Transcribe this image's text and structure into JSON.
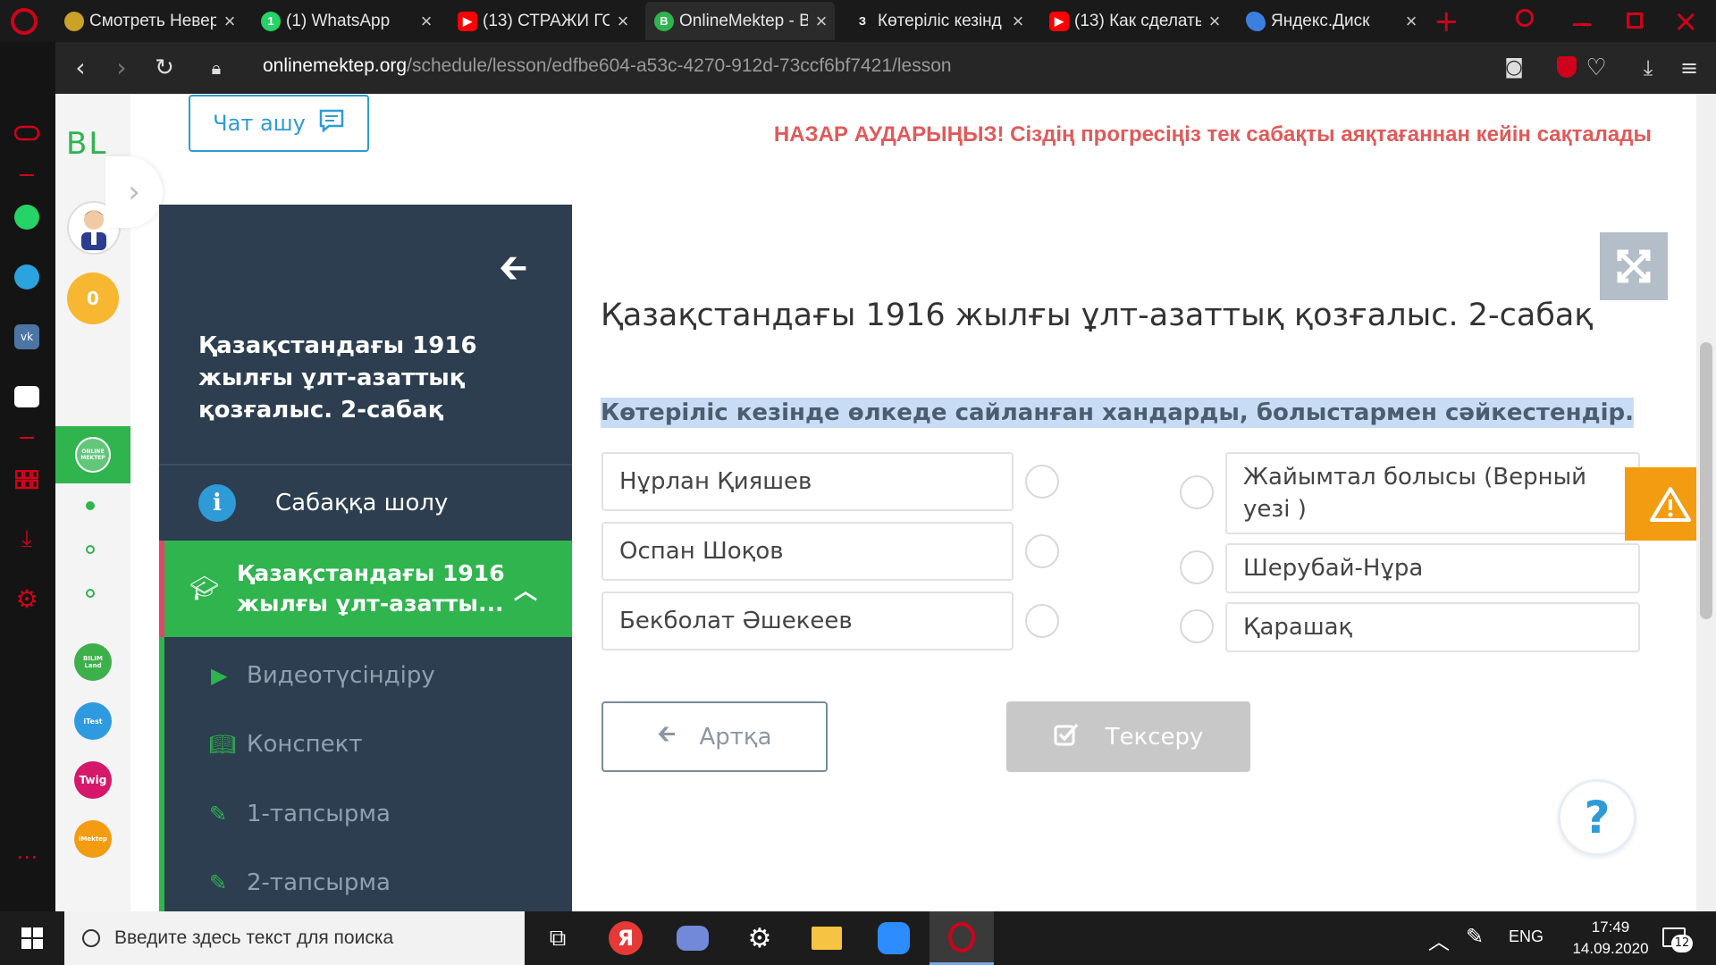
{
  "browser": {
    "tabs": [
      {
        "label": "Смотреть Невер",
        "icon_color": "#c9a227"
      },
      {
        "label": "(1) WhatsApp",
        "icon_color": "#25d366"
      },
      {
        "label": "(13) СТРАЖИ ГО",
        "icon_color": "#ff0000"
      },
      {
        "label": "OnlineMektep - В",
        "icon_color": "#2fb44e"
      },
      {
        "label": "Көтеріліс кезінд",
        "icon_color": "#1a1a1a",
        "icon_text": "З"
      },
      {
        "label": "(13) Как сделать",
        "icon_color": "#ff0000"
      },
      {
        "label": "Яндекс.Диск",
        "icon_color": "#3c7fe0"
      }
    ],
    "url_host": "onlinemektep.org",
    "url_path": "/schedule/lesson/edfbe604-a53c-4270-912d-73ccf6bf7421/lesson"
  },
  "site": {
    "logo": "BL",
    "score": "0",
    "chat_button": "Чат ашу",
    "warning": "НАЗАР АУДАРЫҢЫЗ! Сіздің прогресіңіз тек сабақты аяқтағаннан кейін сақталады",
    "rail_labels": {
      "onlinemektep": "ONLINE MEKTEP",
      "bilimland": "BILIM Land",
      "itest": "iTest",
      "twig": "Twig",
      "imektep": "iMektep"
    }
  },
  "panel": {
    "title": "Қазақстандағы 1916 жылғы ұлт-азаттық қозғалыс. 2-сабақ",
    "overview": "Сабаққа шолу",
    "active_item": "Қазақстандағы 1916 жылғы ұлт-азатты...",
    "sub_items": [
      "Видеотүсіндіру",
      "Конспект",
      "1-тапсырма",
      "2-тапсырма"
    ]
  },
  "lesson": {
    "title": "Қазақстандағы 1916 жылғы ұлт-азаттық қозғалыс. 2-сабақ",
    "question": "Көтеріліс кезінде өлкеде сайланған хандарды, болыстармен сәйкестендір.",
    "left": [
      "Нұрлан Қияшев",
      "Оспан Шоқов",
      "Бекболат Әшекеев"
    ],
    "right": [
      "Жайымтал болысы (Верный уезі )",
      "Шерубай-Нұра",
      "Қарашақ"
    ],
    "back_button": "Артқа",
    "check_button": "Тексеру",
    "help": "?"
  },
  "taskbar": {
    "search_placeholder": "Введите здесь текст для поиска",
    "lang": "ENG",
    "time": "17:49",
    "date": "14.09.2020",
    "notifications": "12"
  },
  "colors": {
    "green": "#2fb44e",
    "dark_panel": "#2c3e50",
    "warning_red": "#e05a5a",
    "highlight": "#c9dcf5",
    "orange": "#f39c12"
  }
}
